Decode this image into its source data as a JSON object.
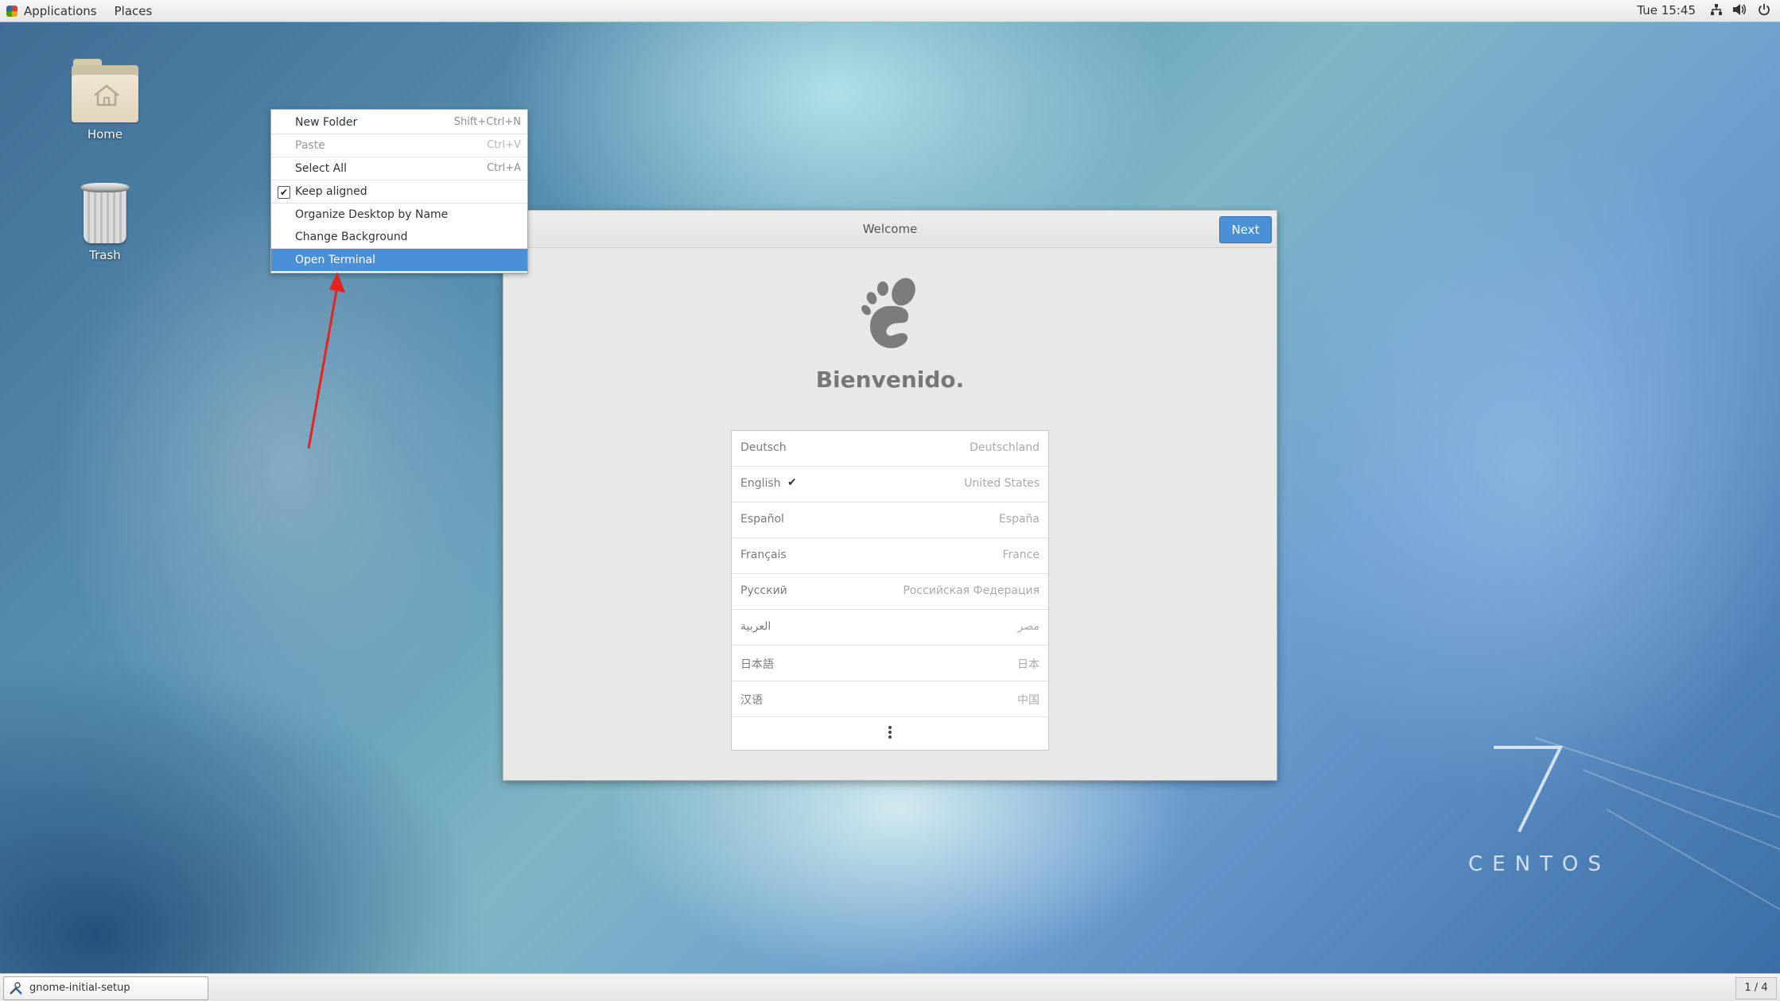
{
  "top_panel": {
    "applications": "Applications",
    "places": "Places",
    "clock": "Tue 15:45",
    "icons": [
      "network-icon",
      "volume-icon",
      "power-icon"
    ]
  },
  "desktop": {
    "icons": [
      {
        "label": "Home",
        "icon": "home-folder-icon"
      },
      {
        "label": "Trash",
        "icon": "trash-icon"
      }
    ]
  },
  "context_menu": {
    "items": [
      {
        "label": "New Folder",
        "accel": "Shift+Ctrl+N",
        "enabled": true
      },
      {
        "label": "Paste",
        "accel": "Ctrl+V",
        "enabled": false
      },
      {
        "label": "Select All",
        "accel": "Ctrl+A",
        "enabled": true
      },
      {
        "label": "Keep aligned",
        "checked": true,
        "enabled": true
      },
      {
        "label": "Organize Desktop by Name",
        "enabled": true
      },
      {
        "label": "Change Background",
        "enabled": true
      },
      {
        "label": "Open Terminal",
        "enabled": true,
        "selected": true
      }
    ]
  },
  "welcome_window": {
    "title": "Welcome",
    "next_label": "Next",
    "heading": "Bienvenido.",
    "languages": [
      {
        "name": "Deutsch",
        "region": "Deutschland"
      },
      {
        "name": "English",
        "region": "United States",
        "selected": true
      },
      {
        "name": "Español",
        "region": "España"
      },
      {
        "name": "Français",
        "region": "France"
      },
      {
        "name": "Русский",
        "region": "Российская Федерация"
      },
      {
        "name": "العربية",
        "region": "مصر"
      },
      {
        "name": "日本語",
        "region": "日本"
      },
      {
        "name": "汉语",
        "region": "中国"
      }
    ],
    "more_icon": "vertical-ellipsis-icon"
  },
  "branding": {
    "version": "7",
    "name": "CENTOS"
  },
  "bottom_panel": {
    "task": "gnome-initial-setup",
    "workspace": "1 / 4"
  },
  "colors": {
    "accent": "#4a90d9",
    "arrow": "#e8231f"
  }
}
